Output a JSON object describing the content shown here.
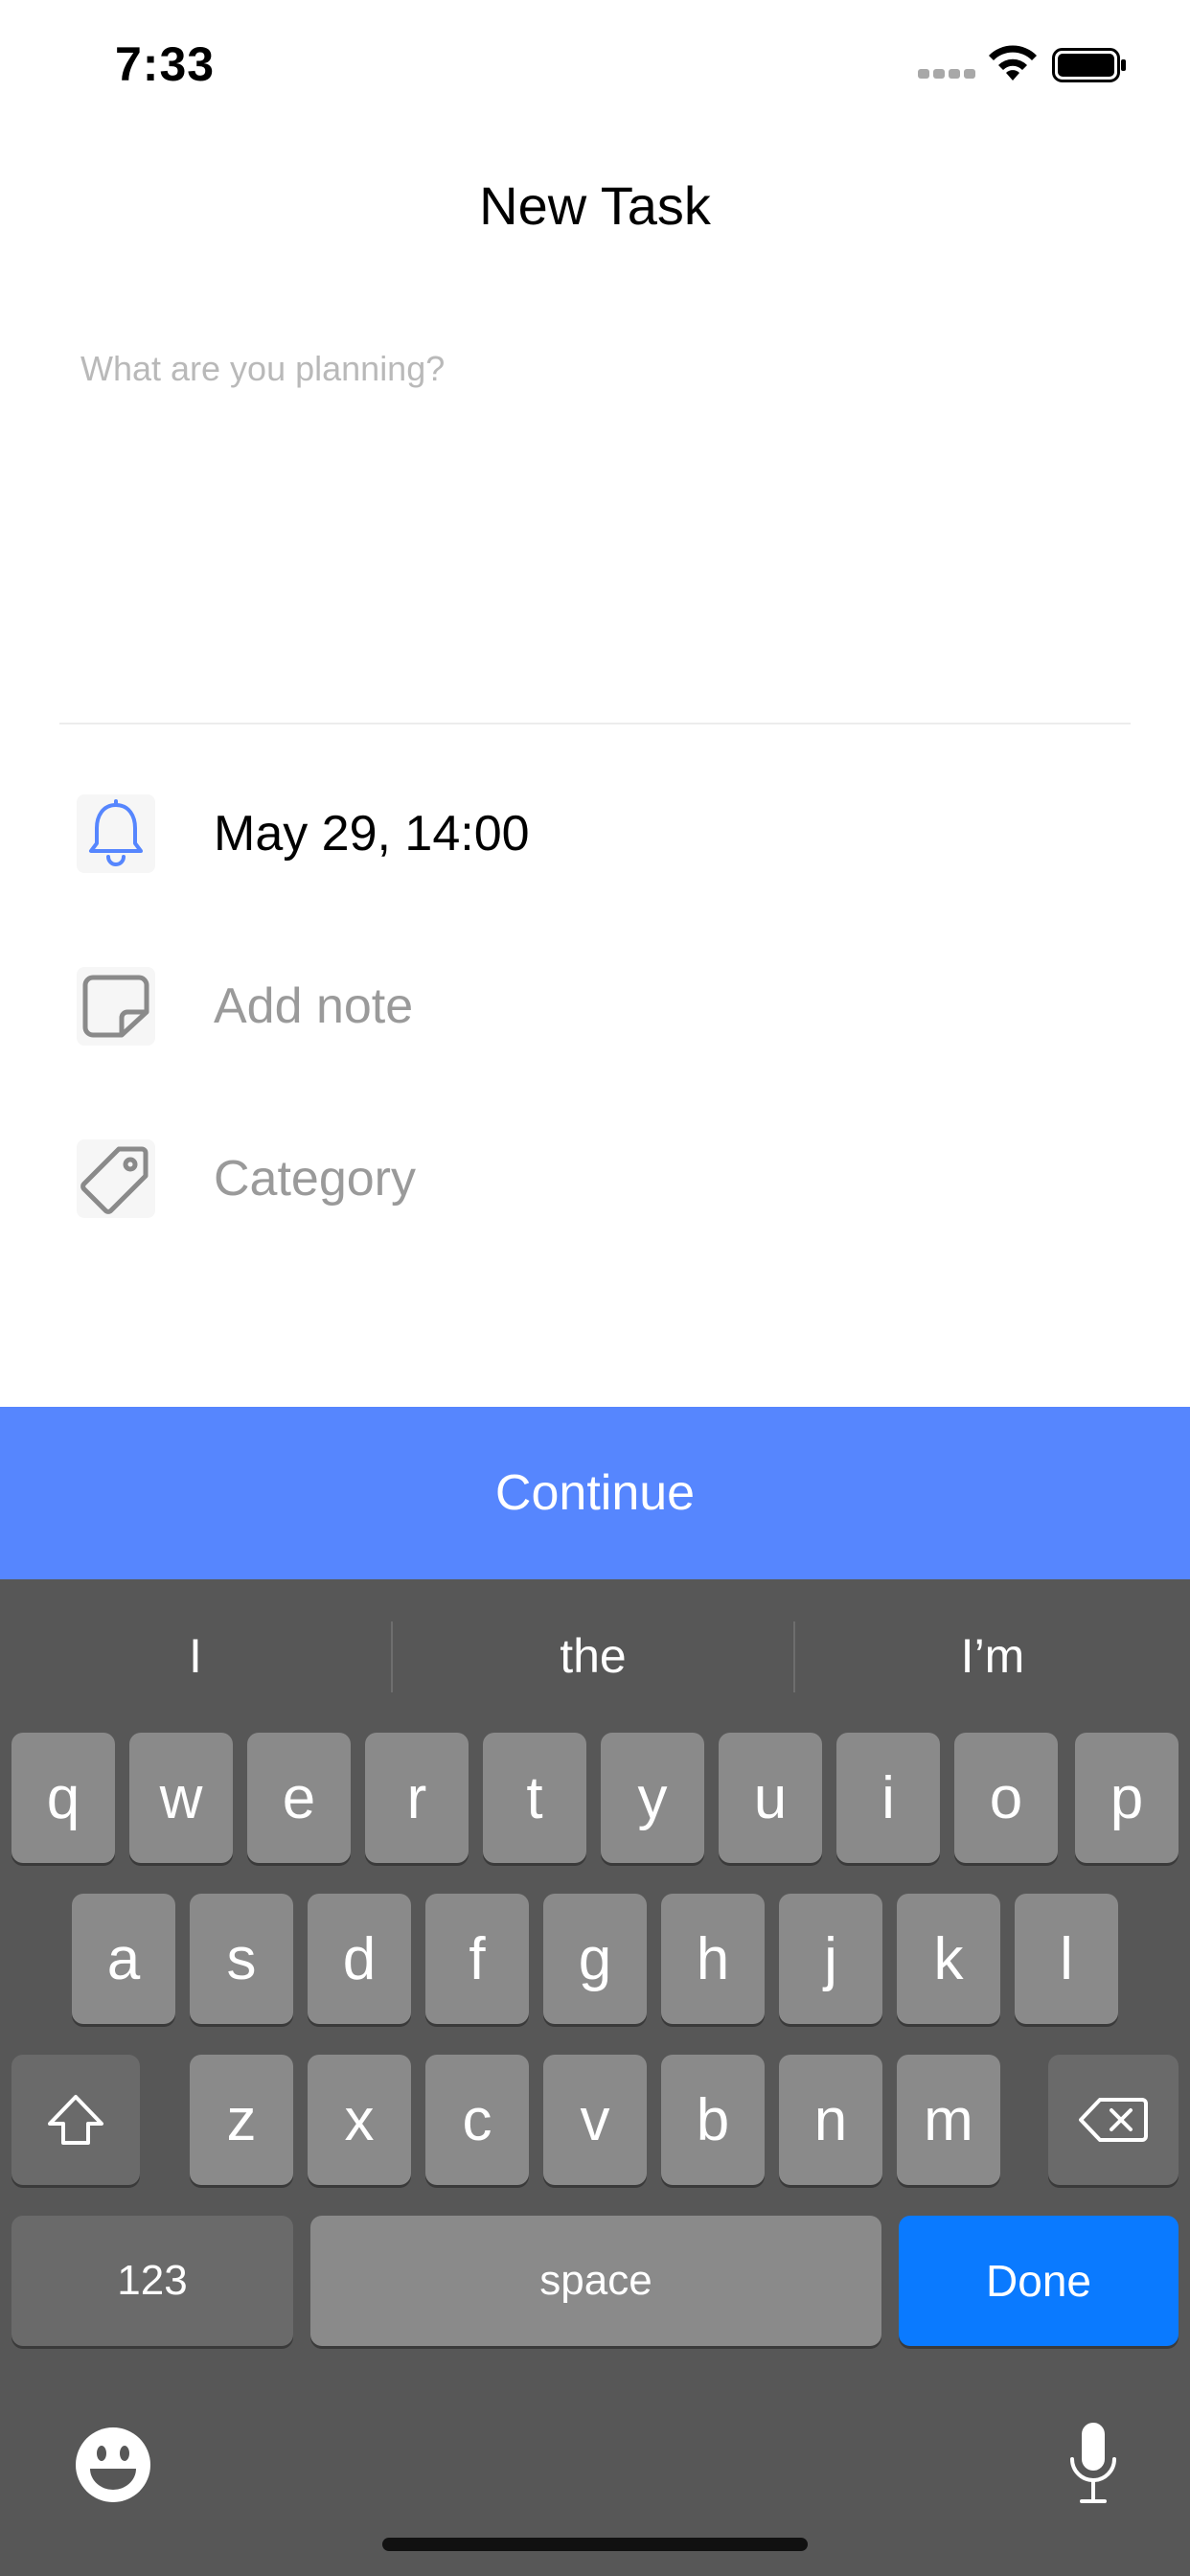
{
  "status_bar": {
    "time": "7:33"
  },
  "header": {
    "title": "New Task"
  },
  "task": {
    "value": "",
    "placeholder": "What are you planning?"
  },
  "options": {
    "reminder": {
      "label": "May 29, 14:00",
      "icon": "bell-icon",
      "icon_color": "#5686fe"
    },
    "note": {
      "label": "Add note",
      "icon": "note-icon"
    },
    "category": {
      "label": "Category",
      "icon": "tag-icon"
    }
  },
  "continue": {
    "label": "Continue",
    "color": "#5686fe"
  },
  "keyboard": {
    "suggestions": [
      "I",
      "the",
      "I’m"
    ],
    "row1": [
      "q",
      "w",
      "e",
      "r",
      "t",
      "y",
      "u",
      "i",
      "o",
      "p"
    ],
    "row2": [
      "a",
      "s",
      "d",
      "f",
      "g",
      "h",
      "j",
      "k",
      "l"
    ],
    "row3": [
      "z",
      "x",
      "c",
      "v",
      "b",
      "n",
      "m"
    ],
    "numbers_label": "123",
    "space_label": "space",
    "done_label": "Done",
    "done_color": "#0a7aff"
  }
}
